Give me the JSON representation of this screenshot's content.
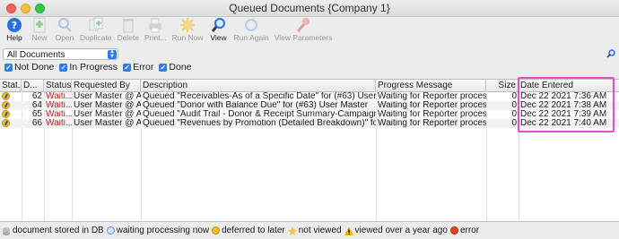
{
  "window": {
    "title": "Queued Documents {Company 1}"
  },
  "toolbar": {
    "items": [
      {
        "label": "Help",
        "icon": "help-icon",
        "enabled": true
      },
      {
        "label": "New",
        "icon": "new-icon",
        "enabled": false
      },
      {
        "label": "Open",
        "icon": "open-icon",
        "enabled": false
      },
      {
        "label": "Duplicate",
        "icon": "duplicate-icon",
        "enabled": false
      },
      {
        "label": "Delete",
        "icon": "delete-icon",
        "enabled": false
      },
      {
        "label": "Print...",
        "icon": "print-icon",
        "enabled": false
      },
      {
        "label": "Run Now",
        "icon": "run-now-icon",
        "enabled": false
      },
      {
        "label": "View",
        "icon": "view-icon",
        "enabled": true
      },
      {
        "label": "Run Again",
        "icon": "run-again-icon",
        "enabled": false
      },
      {
        "label": "View Parameters",
        "icon": "view-parameters-icon",
        "enabled": false
      }
    ]
  },
  "filter": {
    "selected": "All Documents"
  },
  "checkboxes": [
    {
      "label": "Not Done",
      "checked": true
    },
    {
      "label": "In Progress",
      "checked": true
    },
    {
      "label": "Error",
      "checked": true
    },
    {
      "label": "Done",
      "checked": true
    }
  ],
  "table": {
    "headers": [
      "Stat...",
      "D...",
      "Status",
      "Requested By",
      "Description",
      "Progress Message",
      "Size",
      "Date Entered"
    ],
    "rows": [
      {
        "d": "62",
        "status": "Waiti...",
        "requested_by": "User Master @ A...",
        "description": "Queued \"Receivables-As of a Specific Date\" for (#63) User Master",
        "progress": "Waiting for Reporter proces...",
        "size": "0",
        "date": "Dec 22 2021 7:36 AM"
      },
      {
        "d": "64",
        "status": "Waiti...",
        "requested_by": "User Master @ A...",
        "description": "Queued \"Donor with Balance Due\" for (#63) User Master",
        "progress": "Waiting for Reporter proces...",
        "size": "0",
        "date": "Dec 22 2021 7:38 AM"
      },
      {
        "d": "65",
        "status": "Waiti...",
        "requested_by": "User Master @ A...",
        "description": "Queued \"Audit Trail - Donor & Receipt Summary-Campaign\" for...",
        "progress": "Waiting for Reporter proces...",
        "size": "0",
        "date": "Dec 22 2021 7:39 AM"
      },
      {
        "d": "66",
        "status": "Waiti...",
        "requested_by": "User Master @ A...",
        "description": "Queued \"Revenues by Promotion (Detailed Breakdown)\" for (#63...",
        "progress": "Waiting for Reporter proces...",
        "size": "0",
        "date": "Dec 22 2021 7:40 AM"
      }
    ]
  },
  "legend": [
    {
      "label": "document stored in DB",
      "icon": "stored-in-db-icon"
    },
    {
      "label": "waiting processing now",
      "icon": "waiting-icon"
    },
    {
      "label": "deferred to later",
      "icon": "deferred-icon"
    },
    {
      "label": "not viewed",
      "icon": "not-viewed-icon"
    },
    {
      "label": "viewed over a year ago",
      "icon": "viewed-old-icon"
    },
    {
      "label": "error",
      "icon": "error-icon"
    }
  ],
  "colors": {
    "accent": "#2f7bf5",
    "highlight": "#e34dd5",
    "status_waiting": "#b02020"
  }
}
